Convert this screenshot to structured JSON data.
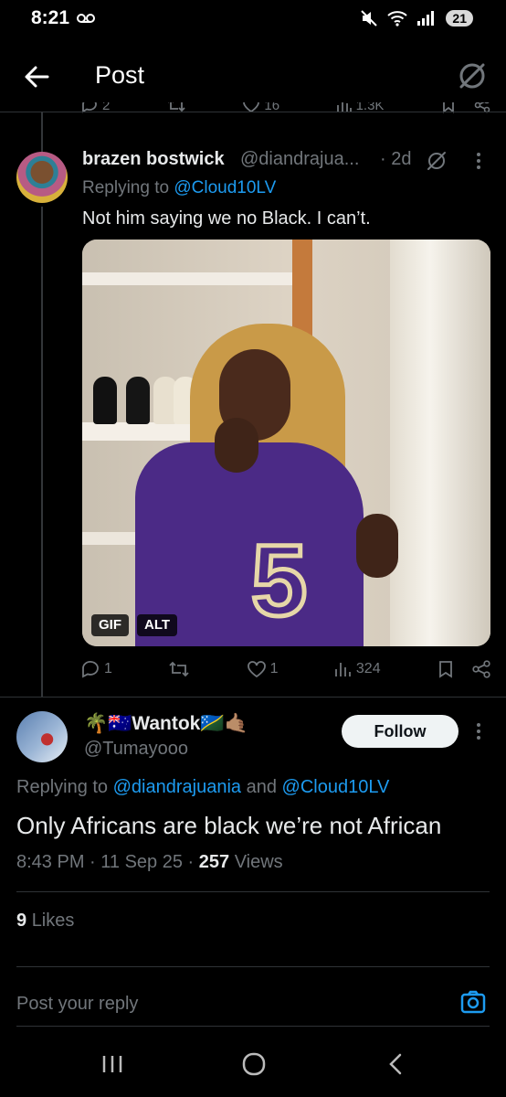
{
  "status_bar": {
    "time": "8:21",
    "voicemail_icon": "voicemail-icon",
    "battery": "21"
  },
  "header": {
    "title": "Post",
    "back_icon": "arrow-left-icon",
    "grok_icon": "grok-icon"
  },
  "partial_actions": {
    "replies": "2",
    "likes": "16",
    "views": "1.3K"
  },
  "reply1": {
    "display_name": "brazen bostwick",
    "handle": "@diandrajua...",
    "time": "· 2d",
    "replying_prefix": "Replying to",
    "replying_to": "@Cloud10LV",
    "text": "Not him saying we no Black. I can’t.",
    "media": {
      "gif_label": "GIF",
      "alt_label": "ALT"
    },
    "actions": {
      "replies": "1",
      "likes": "1",
      "views": "324"
    }
  },
  "reply2": {
    "display_name": "🌴🇦🇺Wantok🇸🇧🤙🏽",
    "handle": "@Tumayooo",
    "follow_label": "Follow",
    "replying_prefix": "Replying to",
    "replying_to_1": "@diandrajuania",
    "replying_and": "and",
    "replying_to_2": "@Cloud10LV",
    "text": "Only Africans are black we’re not African",
    "time": "8:43 PM · 11 Sep 25 ·",
    "views_count": "257",
    "views_label": "Views",
    "likes_count": "9",
    "likes_label": "Likes"
  },
  "composer": {
    "placeholder": "Post your reply"
  },
  "colors": {
    "background": "#000000",
    "text": "#e7e9ea",
    "muted": "#71767b",
    "link": "#1d9bf0",
    "divider": "#2f3336"
  }
}
